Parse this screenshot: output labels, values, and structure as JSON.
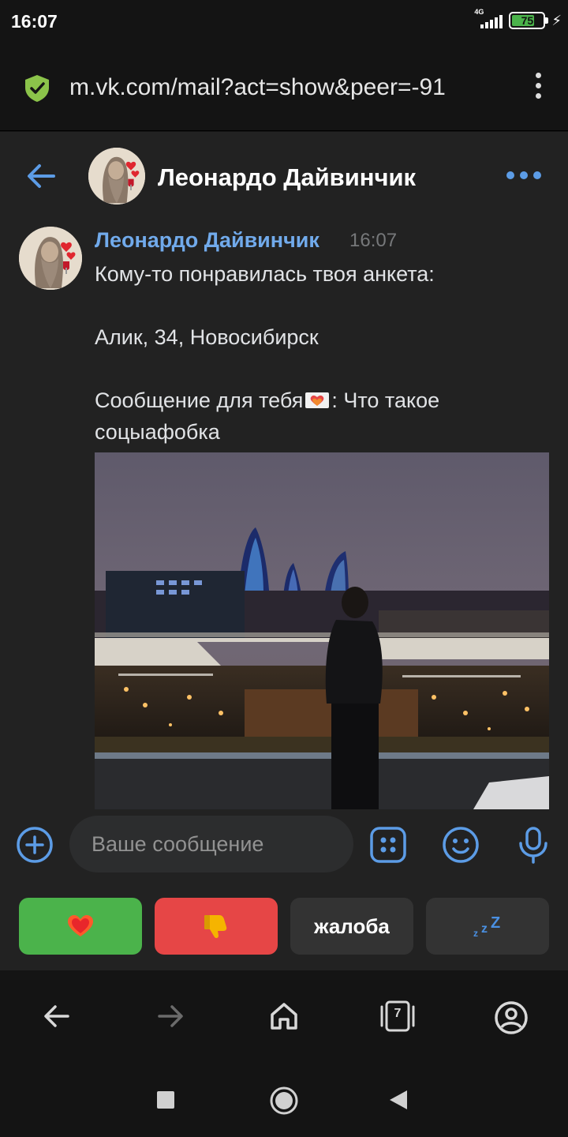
{
  "status_bar": {
    "time": "16:07",
    "network": "4G",
    "battery": "75",
    "battery_level": 0.75
  },
  "browser": {
    "url": "m.vk.com/mail?act=show&peer=-91",
    "tab_count": "7"
  },
  "chat": {
    "title": "Леонардо Дайвинчик",
    "message": {
      "author": "Леонардо Дайвинчик",
      "time": "16:07",
      "line1": "Кому-то понравилась твоя анкета:",
      "line2": "Алик, 34, Новосибирск",
      "line3_before": "Сообщение для тебя",
      "line3_after": ": Что такое соцыафобка"
    }
  },
  "composer": {
    "placeholder": "Ваше сообщение"
  },
  "keyboard": {
    "report_label": "жалоба",
    "sleep_label": "zzZ"
  },
  "colors": {
    "accent": "#71aaeb",
    "like": "#4bb34b",
    "dislike": "#e64646"
  }
}
